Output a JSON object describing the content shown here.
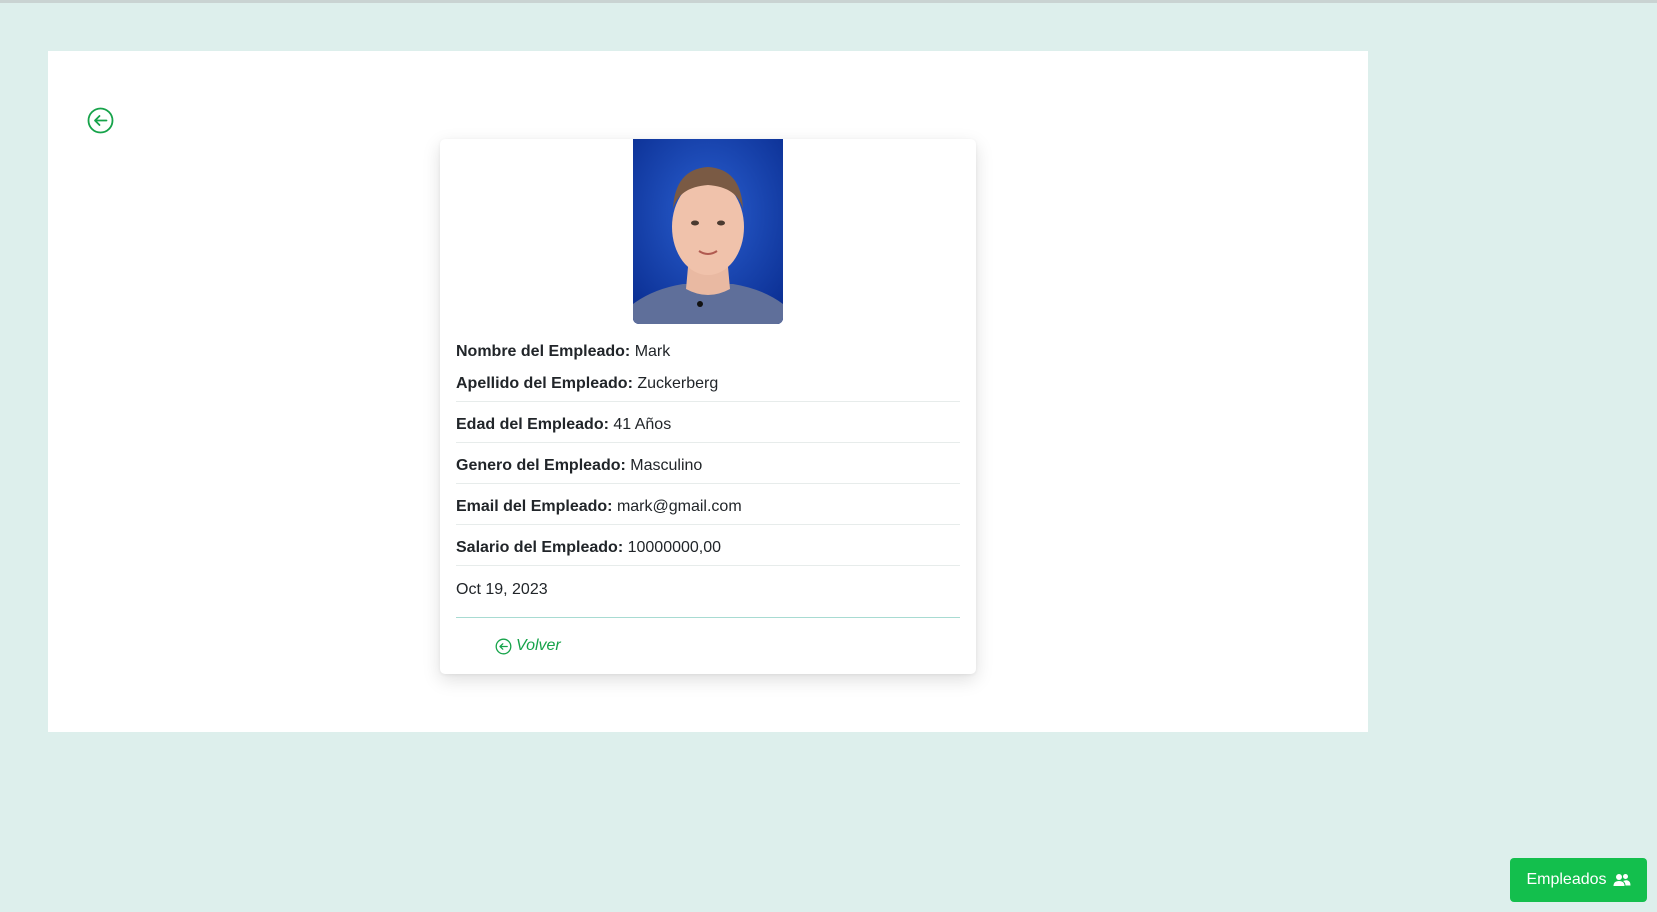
{
  "employee": {
    "nombre_label": "Nombre del Empleado:",
    "nombre": "Mark",
    "apellido_label": "Apellido del Empleado:",
    "apellido": "Zuckerberg",
    "edad_label": "Edad del Empleado:",
    "edad": "41 Años",
    "genero_label": "Genero del Empleado:",
    "genero": "Masculino",
    "email_label": "Email del Empleado:",
    "email": "mark@gmail.com",
    "salario_label": "Salario del Empleado:",
    "salario": "10000000,00",
    "date": "Oct 19, 2023"
  },
  "actions": {
    "volver_label": "Volver",
    "empleados_label": "Empleados"
  },
  "icons": {
    "back": "arrow-left-circle-icon",
    "volver": "arrow-left-circle-icon",
    "empleados": "people-icon"
  },
  "colors": {
    "background": "#ddefec",
    "accent": "#16a34a",
    "button": "#13bf4d"
  }
}
